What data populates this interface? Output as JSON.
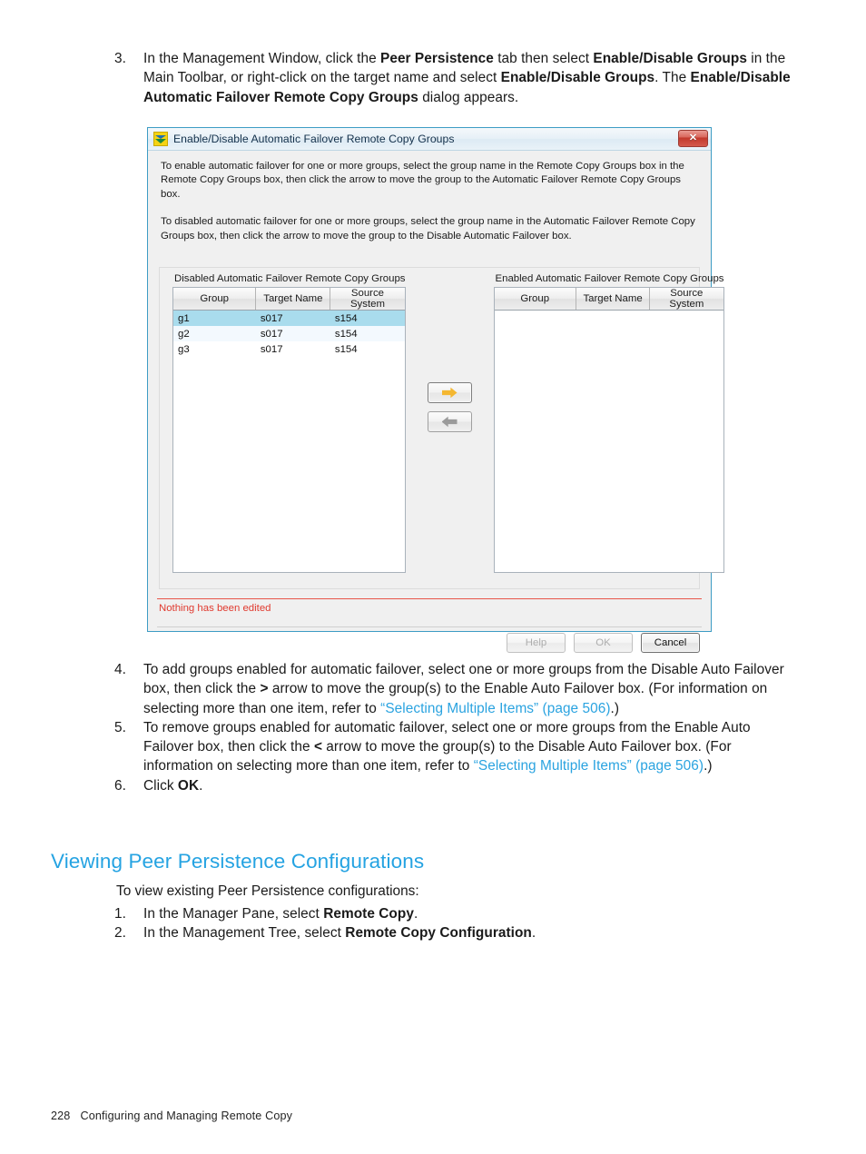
{
  "document": {
    "footer": {
      "page_number": "228",
      "chapter": "Configuring and Managing Remote Copy"
    },
    "steps_top": [
      {
        "num": "3.",
        "segments": [
          {
            "t": "In the Management Window, click the ",
            "s": "plain"
          },
          {
            "t": "Peer Persistence",
            "s": "bold"
          },
          {
            "t": " tab then select ",
            "s": "plain"
          },
          {
            "t": "Enable/Disable Groups",
            "s": "bold"
          },
          {
            "t": " in the Main Toolbar, or right-click on the target name and select ",
            "s": "plain"
          },
          {
            "t": "Enable/Disable Groups",
            "s": "bold"
          },
          {
            "t": ". The ",
            "s": "plain"
          },
          {
            "t": "Enable/Disable Automatic Failover Remote Copy Groups",
            "s": "bold"
          },
          {
            "t": " dialog appears.",
            "s": "plain"
          }
        ]
      }
    ],
    "steps_mid": [
      {
        "num": "4.",
        "segments": [
          {
            "t": "To add groups enabled for automatic failover, select one or more groups from the Disable Auto Failover box, then click the ",
            "s": "plain"
          },
          {
            "t": ">",
            "s": "bold"
          },
          {
            "t": " arrow to move the group(s) to the Enable Auto Failover box. (For information on selecting more than one item, refer to ",
            "s": "plain"
          },
          {
            "t": "“Selecting Multiple Items” (page 506)",
            "s": "link"
          },
          {
            "t": ".)",
            "s": "plain"
          }
        ]
      },
      {
        "num": "5.",
        "segments": [
          {
            "t": "To remove groups enabled for automatic failover, select one or more groups from the Enable Auto Failover box, then click the ",
            "s": "plain"
          },
          {
            "t": "<",
            "s": "bold"
          },
          {
            "t": " arrow to move the group(s) to the Disable Auto Failover box. (For information on selecting more than one item, refer to ",
            "s": "plain"
          },
          {
            "t": "“Selecting Multiple Items” (page 506)",
            "s": "link"
          },
          {
            "t": ".)",
            "s": "plain"
          }
        ]
      },
      {
        "num": "6.",
        "segments": [
          {
            "t": "Click ",
            "s": "plain"
          },
          {
            "t": "OK",
            "s": "bold"
          },
          {
            "t": ".",
            "s": "plain"
          }
        ]
      }
    ],
    "section": {
      "heading": "Viewing Peer Persistence Configurations",
      "intro": "To view existing Peer Persistence configurations:",
      "steps": [
        {
          "num": "1.",
          "segments": [
            {
              "t": "In the Manager Pane, select ",
              "s": "plain"
            },
            {
              "t": "Remote Copy",
              "s": "bold"
            },
            {
              "t": ".",
              "s": "plain"
            }
          ]
        },
        {
          "num": "2.",
          "segments": [
            {
              "t": "In the Management Tree, select ",
              "s": "plain"
            },
            {
              "t": "Remote Copy Configuration",
              "s": "bold"
            },
            {
              "t": ".",
              "s": "plain"
            }
          ]
        }
      ]
    }
  },
  "dialog": {
    "title": "Enable/Disable Automatic Failover Remote Copy Groups",
    "icon": "stacked-disks-icon",
    "close_label": "✕",
    "instructions": [
      "To enable automatic failover for one or more groups, select the group name in the Remote Copy Groups box in the Remote Copy Groups box, then click the arrow to move the group to the Automatic Failover Remote Copy Groups box.",
      "To disabled automatic failover for one or more groups, select the group name in the Automatic Failover Remote Copy Groups box, then click the arrow to move the group to the Disable Automatic Failover box."
    ],
    "left_panel": {
      "caption": "Disabled Automatic Failover Remote Copy Groups",
      "columns": [
        "Group",
        "Target Name",
        "Source System"
      ],
      "rows": [
        {
          "group": "g1",
          "target": "s017",
          "source": "s154",
          "selected": true
        },
        {
          "group": "g2",
          "target": "s017",
          "source": "s154",
          "selected": false
        },
        {
          "group": "g3",
          "target": "s017",
          "source": "s154",
          "selected": false
        }
      ]
    },
    "right_panel": {
      "caption": "Enabled Automatic Failover Remote Copy Groups",
      "columns": [
        "Group",
        "Target Name",
        "Source System"
      ],
      "rows": []
    },
    "arrow_buttons": [
      {
        "name": "move-right-button",
        "icon": "arrow-right-icon",
        "state": "enabled"
      },
      {
        "name": "move-left-button",
        "icon": "arrow-left-icon",
        "state": "disabled"
      }
    ],
    "status_message": "Nothing has been edited",
    "buttons": [
      {
        "label": "Help",
        "state": "disabled"
      },
      {
        "label": "OK",
        "state": "disabled"
      },
      {
        "label": "Cancel",
        "state": "enabled"
      }
    ],
    "colors": {
      "link": "#25a3e2",
      "status": "#e03a2f",
      "selection": "#a9dced",
      "arrow_enabled": "#f4b731",
      "window_border": "#3d9cc4"
    }
  }
}
